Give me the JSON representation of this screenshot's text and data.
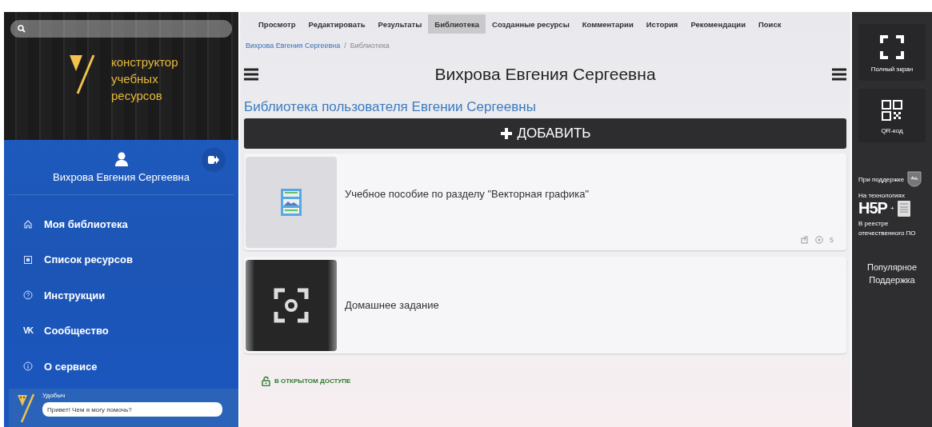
{
  "sidebar": {
    "logo_lines": [
      "конструктор",
      "учебных",
      "ресурсов"
    ],
    "user_name": "Вихрова Евгения Сергеевна",
    "menu": [
      {
        "label": "Моя библиотека",
        "kind": "home"
      },
      {
        "label": "Список ресурсов",
        "kind": "list"
      },
      {
        "label": "Инструкции",
        "kind": "help"
      },
      {
        "label": "Сообщество",
        "kind": "community",
        "icon_text": "VK"
      },
      {
        "label": "О сервисе",
        "kind": "info"
      }
    ],
    "chat": {
      "bot_name": "Удобыч",
      "message": "Привет! Чем я могу помочь?"
    }
  },
  "tabs": [
    {
      "label": "Просмотр",
      "selected": false
    },
    {
      "label": "Редактировать",
      "selected": false
    },
    {
      "label": "Результаты",
      "selected": false
    },
    {
      "label": "Библиотека",
      "selected": true
    },
    {
      "label": "Созданные ресурсы",
      "selected": false
    },
    {
      "label": "Комментарии",
      "selected": false
    },
    {
      "label": "История",
      "selected": false
    },
    {
      "label": "Рекомендации",
      "selected": false
    },
    {
      "label": "Поиск",
      "selected": false
    }
  ],
  "breadcrumb_separator": "/",
  "breadcrumb": [
    {
      "label": "Вихрова Евгения Сергеевна",
      "link": true
    },
    {
      "label": "Библиотека",
      "link": false
    }
  ],
  "page_title": "Вихрова Евгения Сергеевна",
  "library_title": "Библиотека пользователя Евгении Сергеевны",
  "add_button": "ДОБАВИТЬ",
  "resources": [
    {
      "title": "Учебное пособие по разделу \"Векторная графика\"",
      "kind": "document",
      "views": "5"
    },
    {
      "title": "Домашнее задание",
      "kind": "photo"
    }
  ],
  "public_label": "В ОТКРЫТОМ ДОСТУПЕ",
  "right_panel": {
    "fullscreen": "Полный экран",
    "qr": "QR-код",
    "support": "При поддержке",
    "tech": "На технологиях",
    "h5p": "H5P",
    "plus": "+",
    "registry": "В реестре отечественного ПО",
    "links": [
      "Популярное",
      "Поддержка"
    ]
  }
}
